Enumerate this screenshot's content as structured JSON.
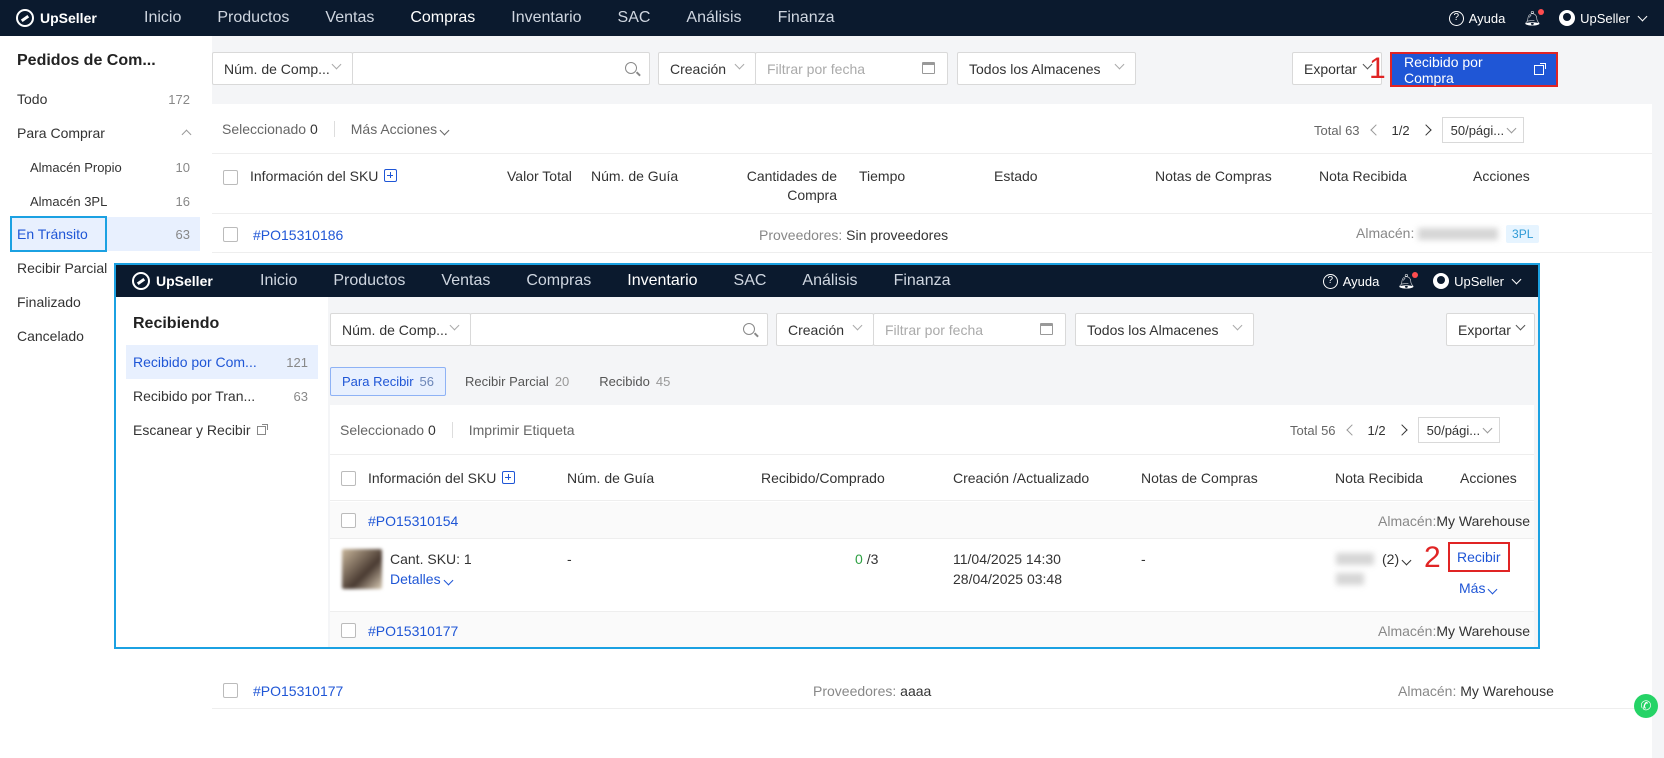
{
  "brand": "UpSeller",
  "topnav": [
    "Inicio",
    "Productos",
    "Ventas",
    "Compras",
    "Inventario",
    "SAC",
    "Análisis",
    "Finanza"
  ],
  "topright": {
    "help": "Ayuda",
    "user": "UpSeller"
  },
  "sidebar": {
    "title": "Pedidos de Com...",
    "items": [
      {
        "label": "Todo",
        "count": "172"
      },
      {
        "label": "Para Comprar",
        "count": ""
      },
      {
        "label": "Almacén Propio",
        "count": "10"
      },
      {
        "label": "Almacén 3PL",
        "count": "16"
      },
      {
        "label": "En Tránsito",
        "count": "63"
      },
      {
        "label": "Recibir Parcial",
        "count": ""
      },
      {
        "label": "Finalizado",
        "count": ""
      },
      {
        "label": "Cancelado",
        "count": ""
      }
    ]
  },
  "filters": {
    "search_type": "Núm. de Comp...",
    "date_type": "Creación",
    "date_placeholder": "Filtrar por fecha",
    "warehouse": "Todos los Almacenes",
    "export": "Exportar",
    "primary_button": "Recibido por Compra",
    "step1": "1"
  },
  "toolbar": {
    "selected_label": "Seleccionado",
    "selected_count": "0",
    "more_actions": "Más Acciones"
  },
  "pager": {
    "total": "Total 63",
    "page": "1/2",
    "per_page": "50/pági..."
  },
  "table_headers": [
    "Información del SKU",
    "Valor Total",
    "Núm. de Guía",
    "Cantidades de Compra",
    "Tiempo",
    "Estado",
    "Notas de Compras",
    "Nota Recibida",
    "Acciones"
  ],
  "rows": [
    {
      "po": "#PO15310186",
      "supplier_label": "Proveedores:",
      "supplier": "Sin proveedores",
      "warehouse_label": "Almacén:",
      "tag": "3PL"
    },
    {
      "po": "#PO15310177",
      "supplier_label": "Proveedores:",
      "supplier": "aaaa",
      "warehouse_label": "Almacén:",
      "warehouse": "My Warehouse"
    }
  ],
  "overlay": {
    "topnav_active": "Inventario",
    "side_title": "Recibiendo",
    "side_items": [
      {
        "label": "Recibido por Com...",
        "count": "121"
      },
      {
        "label": "Recibido por Tran...",
        "count": "63"
      },
      {
        "label": "Escanear y Recibir",
        "count": ""
      }
    ],
    "filters": {
      "search_type": "Núm. de Comp...",
      "date_type": "Creación",
      "date_placeholder": "Filtrar por fecha",
      "warehouse": "Todos los Almacenes",
      "export": "Exportar"
    },
    "tabs": [
      {
        "label": "Para Recibir",
        "count": "56"
      },
      {
        "label": "Recibir Parcial",
        "count": "20"
      },
      {
        "label": "Recibido",
        "count": "45"
      }
    ],
    "toolbar": {
      "selected_label": "Seleccionado",
      "selected_count": "0",
      "print": "Imprimir Etiqueta"
    },
    "pager": {
      "total": "Total 56",
      "page": "1/2",
      "per_page": "50/pági..."
    },
    "headers": [
      "Información del SKU",
      "Núm. de Guía",
      "Recibido/Comprado",
      "Creación /Actualizado",
      "Notas de Compras",
      "Nota Recibida",
      "Acciones"
    ],
    "order1": {
      "po": "#PO15310154",
      "warehouse_label": "Almacén:",
      "warehouse": "My Warehouse",
      "sku_count": "Cant. SKU: 1",
      "details": "Detalles",
      "guide": "-",
      "received": "0",
      "ordered": "/3",
      "created": "11/04/2025 14:30",
      "updated": "28/04/2025 03:48",
      "notes": "-",
      "note_count": "(2)",
      "receive": "Recibir",
      "more": "Más",
      "step2": "2"
    },
    "order2": {
      "po": "#PO15310177",
      "warehouse_label": "Almacén:",
      "warehouse": "My Warehouse"
    }
  },
  "colors": {
    "topbar": "#0b1a2e",
    "accent": "#1f56d6",
    "highlight_red": "#e02424",
    "highlight_blue": "#1ba1e2",
    "green": "#2ea043"
  }
}
